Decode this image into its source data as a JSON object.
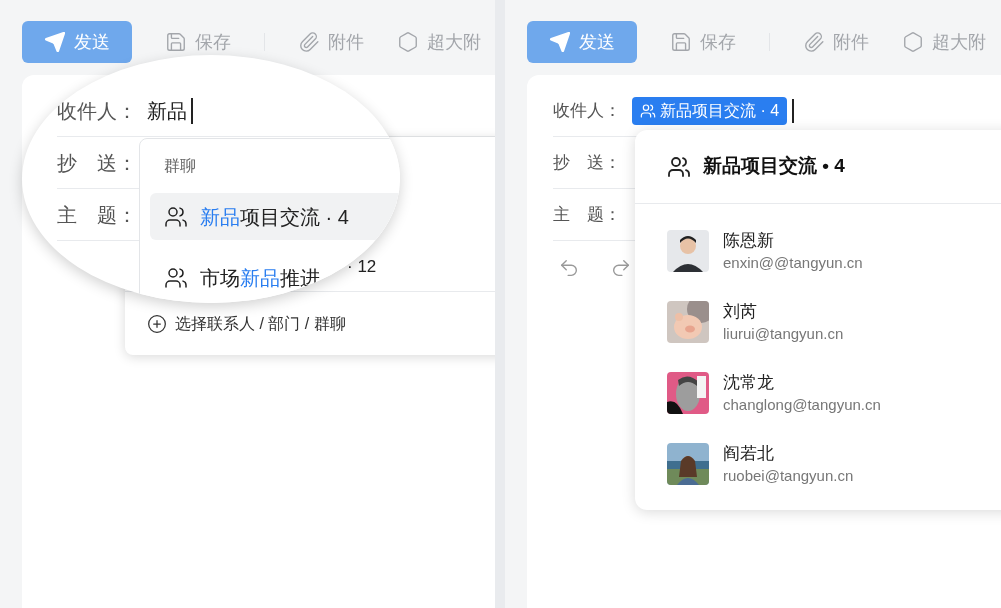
{
  "left_panel": {
    "toolbar": [
      {
        "kind": "send",
        "label": "发送"
      },
      {
        "kind": "save",
        "label": "保存"
      },
      {
        "kind": "attach",
        "label": "附件"
      },
      {
        "kind": "bigfile",
        "label": "超大附"
      }
    ],
    "magnifier": {
      "fields": [
        {
          "label": "收件人：",
          "value": "新品"
        },
        {
          "label": "抄　送："
        },
        {
          "label": "主　题："
        }
      ],
      "dropdown": {
        "section": "群聊",
        "items": [
          {
            "match": "新品",
            "after": "项目交流 · 4",
            "selected": true
          },
          {
            "before": "市场",
            "match": "新品",
            "after": "推进",
            "selected": false
          }
        ]
      }
    },
    "dropdown": {
      "visible_count": "· 12",
      "footer": "选择联系人 / 部门 / 群聊"
    }
  },
  "right_panel": {
    "toolbar": [
      {
        "kind": "send",
        "label": "发送"
      },
      {
        "kind": "save",
        "label": "保存"
      },
      {
        "kind": "attach",
        "label": "附件"
      },
      {
        "kind": "bigfile",
        "label": "超大附"
      }
    ],
    "fields": [
      {
        "label": "收件人：",
        "chip": "新品项目交流 · 4"
      },
      {
        "label": "抄　送："
      },
      {
        "label": "主　题："
      }
    ],
    "group_card": {
      "title": "新品项目交流 • 4",
      "members": [
        {
          "name": "陈恩新",
          "email": "enxin@@tangyun.cn"
        },
        {
          "name": "刘芮",
          "email": "liurui@tangyun.cn"
        },
        {
          "name": "沈常龙",
          "email": "changlong@tangyun.cn"
        },
        {
          "name": "阎若北",
          "email": "ruobei@tangyun.cn"
        }
      ]
    }
  }
}
